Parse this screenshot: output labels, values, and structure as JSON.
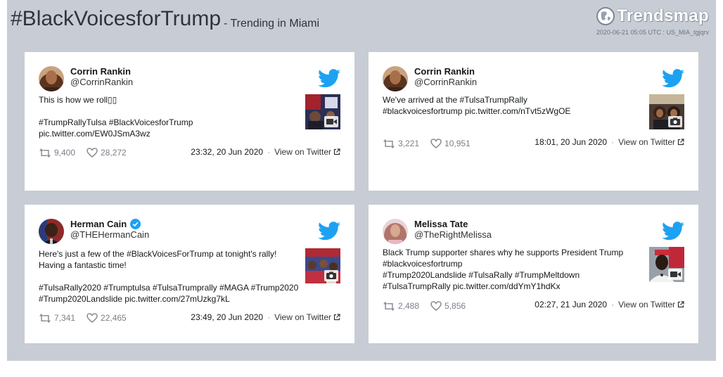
{
  "header": {
    "title": "#BlackVoicesforTrump",
    "subtitle": "- Trending in Miami",
    "logo_text": "Trendsmap",
    "timestamp": "2020-06-21 05:05 UTC : US_MIA_tgjqrv"
  },
  "colors": {
    "panel": "#c8ccd5",
    "twitter_blue": "#1da1f2",
    "verified_blue": "#1da1f2"
  },
  "view_label": "View on Twitter",
  "tweets": [
    {
      "name": "Corrin Rankin",
      "handle": "@CorrinRankin",
      "verified": false,
      "text": "This is how we roll▯▯\n\n#TrumpRallyTulsa #BlackVoicesforTrump\npic.twitter.com/EW0JSmA3wz",
      "retweets": "9,400",
      "likes": "28,272",
      "time": "23:32, 20 Jun 2020",
      "media": "video-icon"
    },
    {
      "name": "Corrin Rankin",
      "handle": "@CorrinRankin",
      "verified": false,
      "text": "We've arrived at the #TulsaTrumpRally\n#blackvoicesfortrump pic.twitter.com/nTvt5zWgOE",
      "retweets": "3,221",
      "likes": "10,951",
      "time": "18:01, 20 Jun 2020",
      "media": "camera-icon"
    },
    {
      "name": "Herman Cain",
      "handle": "@THEHermanCain",
      "verified": true,
      "text": "Here's just a few of the #BlackVoicesForTrump at tonight's rally!\nHaving a fantastic time!\n\n#TulsaRally2020 #Trumptulsa #TulsaTrumprally #MAGA #Trump2020\n#Trump2020Landslide pic.twitter.com/27mUzkg7kL",
      "retweets": "7,341",
      "likes": "22,465",
      "time": "23:49, 20 Jun 2020",
      "media": "camera-icon"
    },
    {
      "name": "Melissa Tate",
      "handle": "@TheRightMelissa",
      "verified": false,
      "text": "Black Trump supporter shares why he supports President Trump\n#blackvoicesfortrump\n#Trump2020Landslide #TulsaRally #TrumpMeltdown\n#TulsaTrumpRally pic.twitter.com/ddYmY1hdKx",
      "retweets": "2,488",
      "likes": "5,856",
      "time": "02:27, 21 Jun 2020",
      "media": "video-icon"
    }
  ]
}
